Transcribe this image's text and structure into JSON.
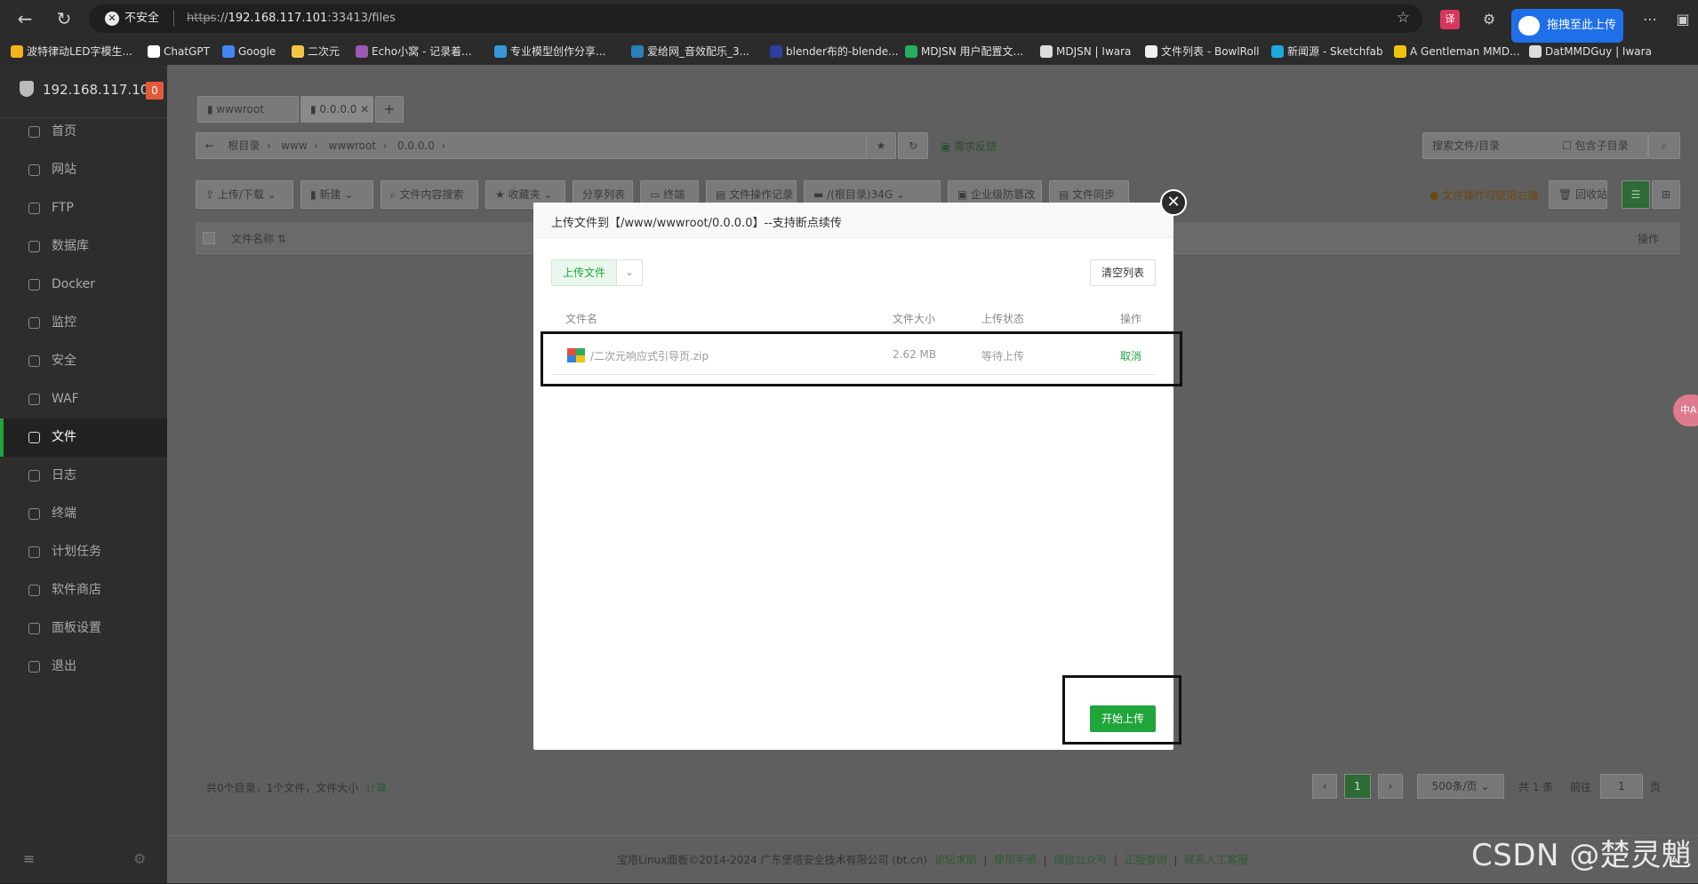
{
  "browser": {
    "insecure_label": "不安全",
    "url_scheme": "https",
    "url_host": "192.168.117.101",
    "url_rest": ":33413/files",
    "upload_ext_label": "拖拽至此上传",
    "bookmarks": [
      {
        "label": "波特律动LED字模生...",
        "color": "#f2b31c"
      },
      {
        "label": "ChatGPT",
        "color": "#ffffff"
      },
      {
        "label": "Google",
        "color": "#4285f4"
      },
      {
        "label": "二次元",
        "color": "#f5c542"
      },
      {
        "label": "Echo小窝 - 记录着...",
        "color": "#9b59b6"
      },
      {
        "label": "专业模型创作分享...",
        "color": "#3498db"
      },
      {
        "label": "爱给网_音效配乐_3...",
        "color": "#2980b9"
      },
      {
        "label": "blender布的-blende...",
        "color": "#2c3e9e"
      },
      {
        "label": "MDJSN 用户配置文...",
        "color": "#27ae60"
      },
      {
        "label": "MDJSN | Iwara",
        "color": "#dddddd"
      },
      {
        "label": "文件列表 - BowlRoll",
        "color": "#eeeeee"
      },
      {
        "label": "新闻源 - Sketchfab",
        "color": "#1caad9"
      },
      {
        "label": "A Gentleman MMD...",
        "color": "#f1c40f"
      },
      {
        "label": "DatMMDGuy | Iwara",
        "color": "#dddddd"
      }
    ]
  },
  "sidebar": {
    "server_ip": "192.168.117.101",
    "badge": "0",
    "items": [
      {
        "label": "首页"
      },
      {
        "label": "网站"
      },
      {
        "label": "FTP"
      },
      {
        "label": "数据库"
      },
      {
        "label": "Docker"
      },
      {
        "label": "监控"
      },
      {
        "label": "安全"
      },
      {
        "label": "WAF"
      },
      {
        "label": "文件"
      },
      {
        "label": "日志"
      },
      {
        "label": "终端"
      },
      {
        "label": "计划任务"
      },
      {
        "label": "软件商店"
      },
      {
        "label": "面板设置"
      },
      {
        "label": "退出"
      }
    ],
    "active_index": 8
  },
  "filemgr": {
    "tabs": [
      "wwwroot",
      "0.0.0.0"
    ],
    "crumbs": [
      "根目录",
      "www",
      "wwwroot",
      "0.0.0.0"
    ],
    "feedback": "需求反馈",
    "search_placeholder": "搜索文件/目录",
    "include_sub": "包含子目录",
    "toolbar": [
      "上传/下载",
      "新建",
      "文件内容搜索",
      "收藏夹",
      "分享列表",
      "终端",
      "文件操作记录",
      "/(根目录)34G",
      "企业级防篡改",
      "文件同步"
    ],
    "right_tip": "文件操作可使用右键",
    "recycle": "回收站",
    "col_name": "文件名称",
    "col_op": "操作",
    "summary": "共0个目录，1个文件，文件大小",
    "calc": "计算",
    "page_current": "1",
    "page_size": "500条/页",
    "total": "共 1 条",
    "goto": "前往",
    "goto_value": "1",
    "page_unit": "页"
  },
  "footer": {
    "copyright": "宝塔Linux面板©2014-2024 广东堡塔安全技术有限公司 (bt.cn)",
    "links": [
      "论坛求助",
      "使用手册",
      "微信公众号",
      "正版查询",
      "联系人工客服"
    ]
  },
  "dialog": {
    "title": "上传文件到【/www/wwwroot/0.0.0.0】--支持断点续传",
    "upload_file_btn": "上传文件",
    "clear_btn": "清空列表",
    "columns": {
      "name": "文件名",
      "size": "文件大小",
      "status": "上传状态",
      "op": "操作"
    },
    "file": {
      "name": "/二次元响应式引导页.zip",
      "size": "2.62 MB",
      "status": "等待上传",
      "cancel": "取消"
    },
    "start_btn": "开始上传"
  },
  "watermark": "CSDN @楚灵魈",
  "float_translate": "中A"
}
